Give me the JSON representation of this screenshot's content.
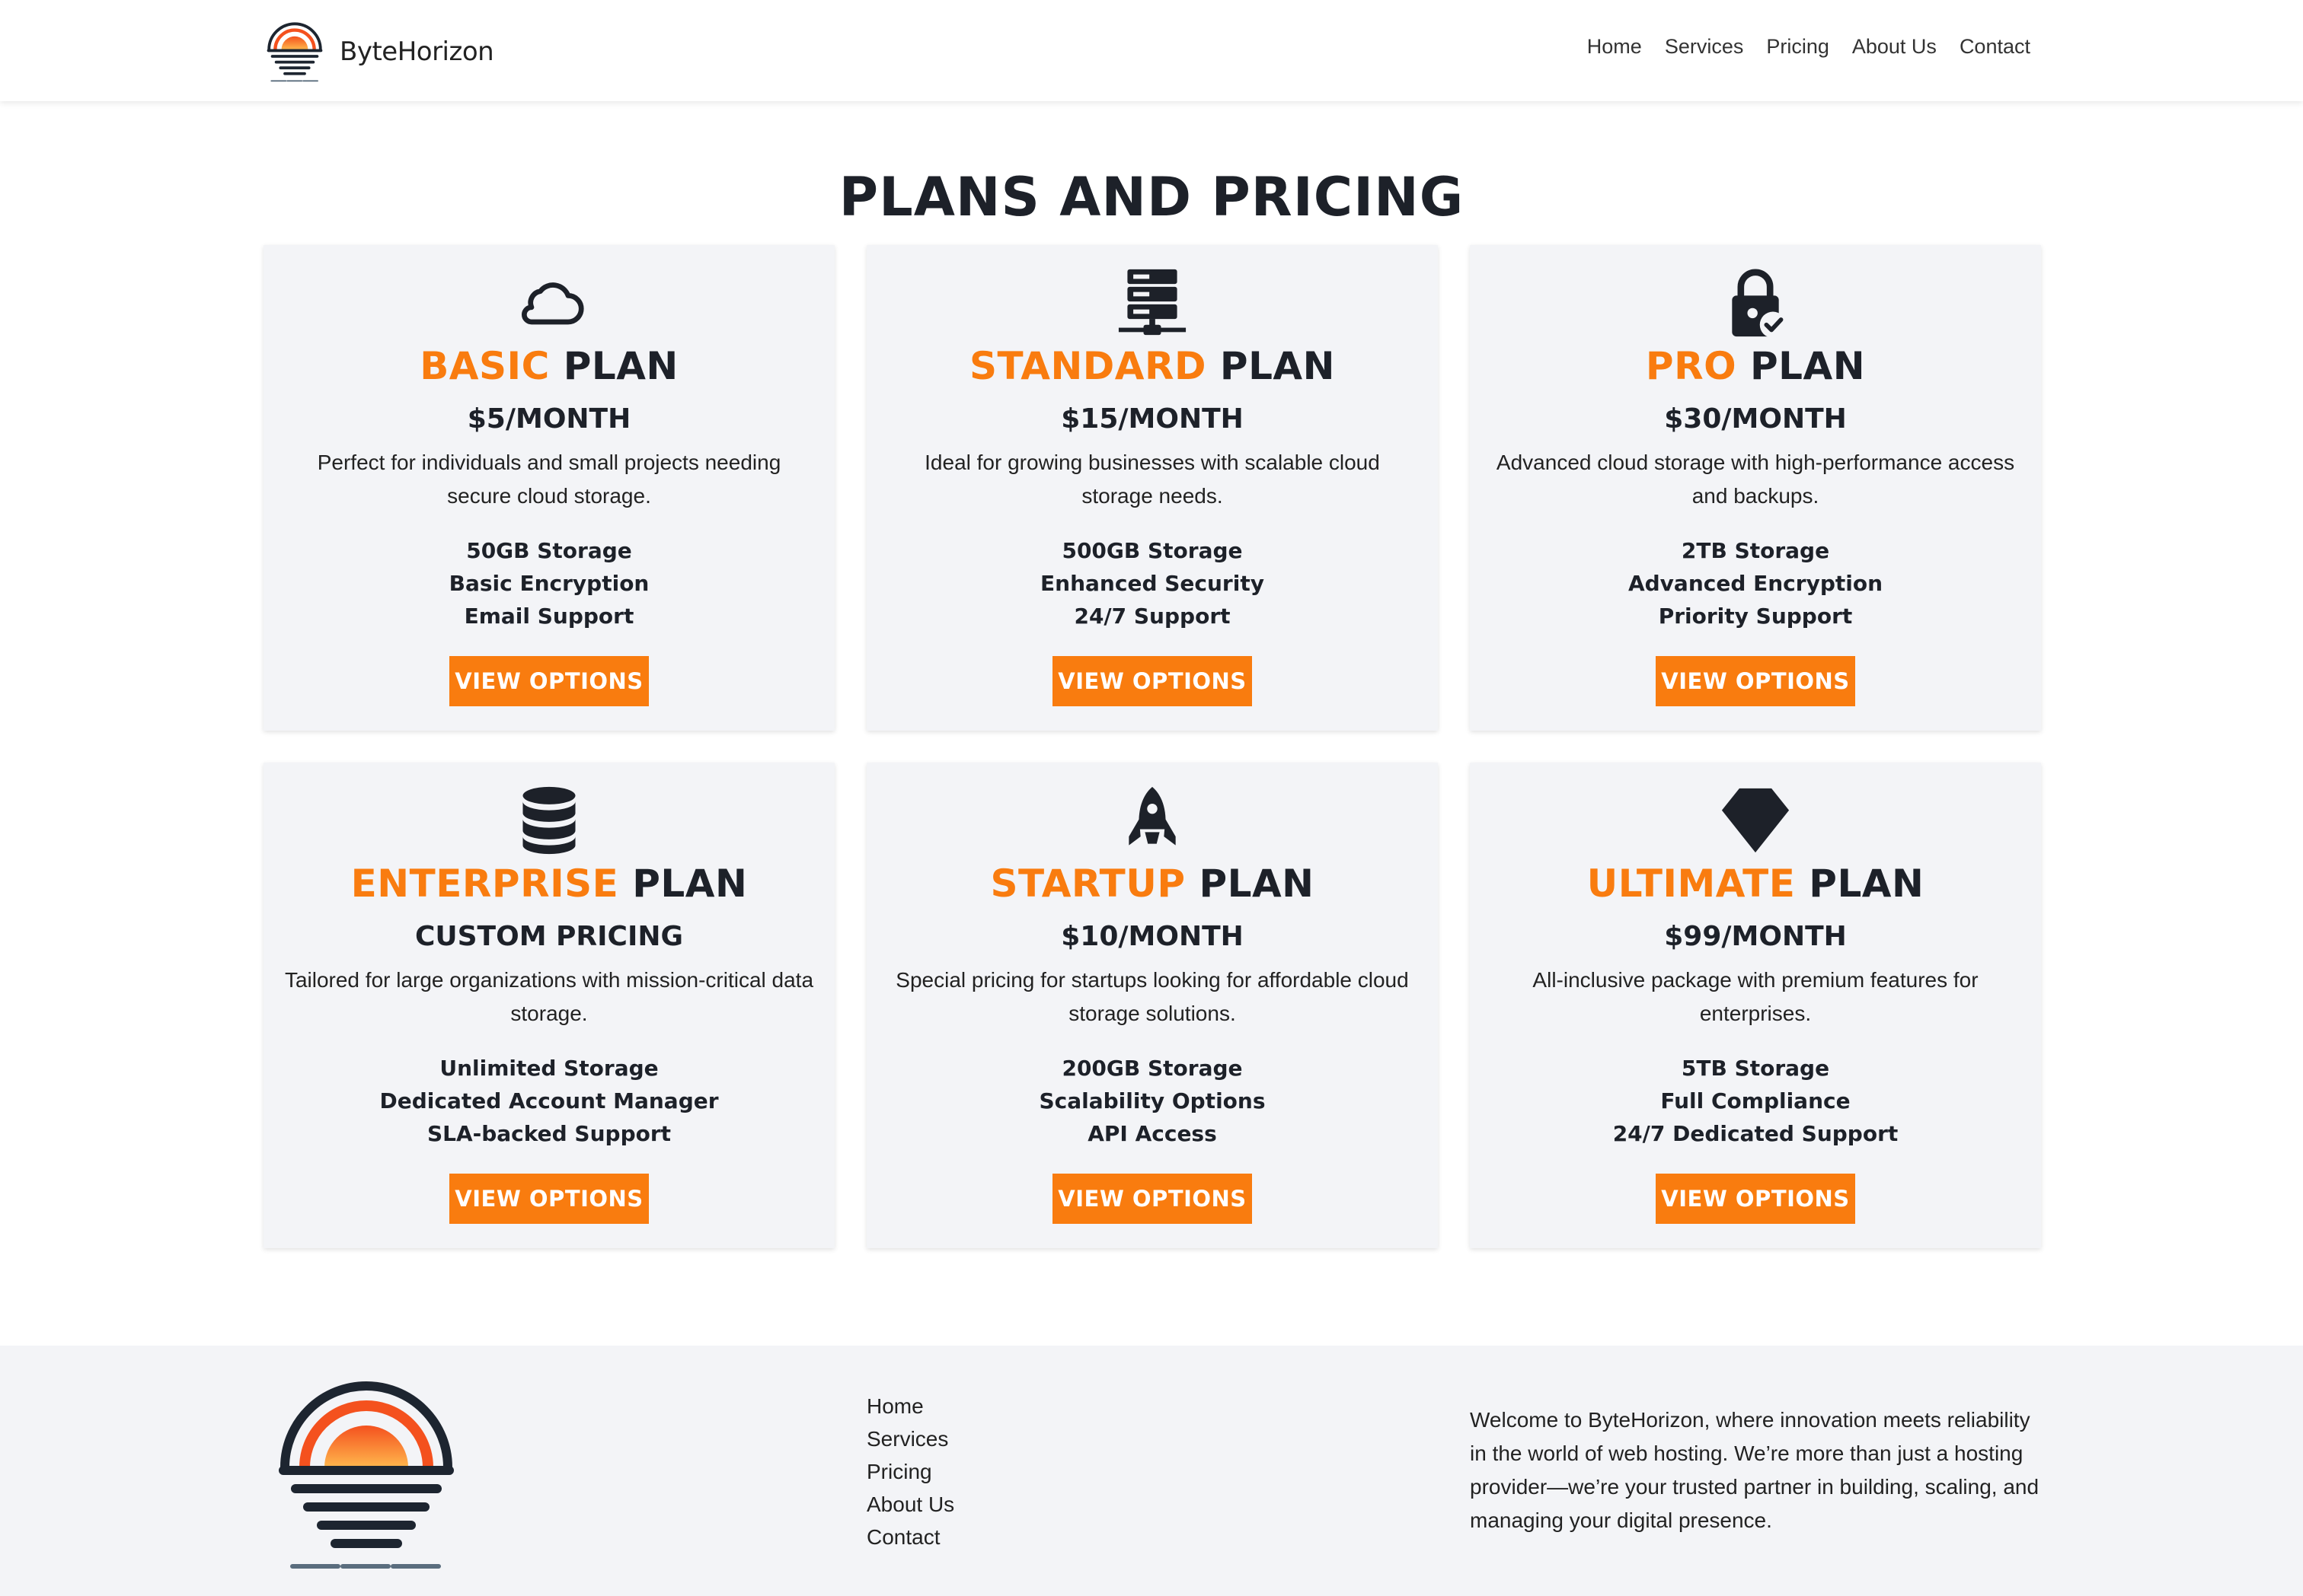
{
  "header": {
    "brand": "ByteHorizon",
    "nav": [
      "Home",
      "Services",
      "Pricing",
      "About Us",
      "Contact"
    ]
  },
  "page_title": "PLANS AND PRICING",
  "plans": [
    {
      "name_accent": "BASIC",
      "name_rest": "PLAN",
      "price": "$5/MONTH",
      "description": "Perfect for individuals and small projects needing secure cloud storage.",
      "features": [
        "50GB Storage",
        "Basic Encryption",
        "Email Support"
      ],
      "button": "VIEW OPTIONS",
      "icon": "cloud-icon"
    },
    {
      "name_accent": "STANDARD",
      "name_rest": "PLAN",
      "price": "$15/MONTH",
      "description": "Ideal for growing businesses with scalable cloud storage needs.",
      "features": [
        "500GB Storage",
        "Enhanced Security",
        "24/7 Support"
      ],
      "button": "VIEW OPTIONS",
      "icon": "server-icon"
    },
    {
      "name_accent": "PRO",
      "name_rest": "PLAN",
      "price": "$30/MONTH",
      "description": "Advanced cloud storage with high-performance access and backups.",
      "features": [
        "2TB Storage",
        "Advanced Encryption",
        "Priority Support"
      ],
      "button": "VIEW OPTIONS",
      "icon": "lock-check-icon"
    },
    {
      "name_accent": "ENTERPRISE",
      "name_rest": "PLAN",
      "price": "CUSTOM PRICING",
      "description": "Tailored for large organizations with mission-critical data storage.",
      "features": [
        "Unlimited Storage",
        "Dedicated Account Manager",
        "SLA-backed Support"
      ],
      "button": "VIEW OPTIONS",
      "icon": "database-icon"
    },
    {
      "name_accent": "STARTUP",
      "name_rest": "PLAN",
      "price": "$10/MONTH",
      "description": "Special pricing for startups looking for affordable cloud storage solutions.",
      "features": [
        "200GB Storage",
        "Scalability Options",
        "API Access"
      ],
      "button": "VIEW OPTIONS",
      "icon": "rocket-icon"
    },
    {
      "name_accent": "ULTIMATE",
      "name_rest": "PLAN",
      "price": "$99/MONTH",
      "description": "All-inclusive package with premium features for enterprises.",
      "features": [
        "5TB Storage",
        "Full Compliance",
        "24/7 Dedicated Support"
      ],
      "button": "VIEW OPTIONS",
      "icon": "gem-icon"
    }
  ],
  "footer": {
    "links": [
      "Home",
      "Services",
      "Pricing",
      "About Us",
      "Contact"
    ],
    "about": "Welcome to ByteHorizon, where innovation meets reliability in the world of web hosting. We’re more than just a hosting provider—we’re your trusted partner in building, scaling, and managing your digital presence."
  },
  "colors": {
    "accent": "#f97c0f",
    "dark": "#1d2129",
    "card_bg": "#f3f4f7",
    "footer_bg": "#f3f4f7"
  }
}
